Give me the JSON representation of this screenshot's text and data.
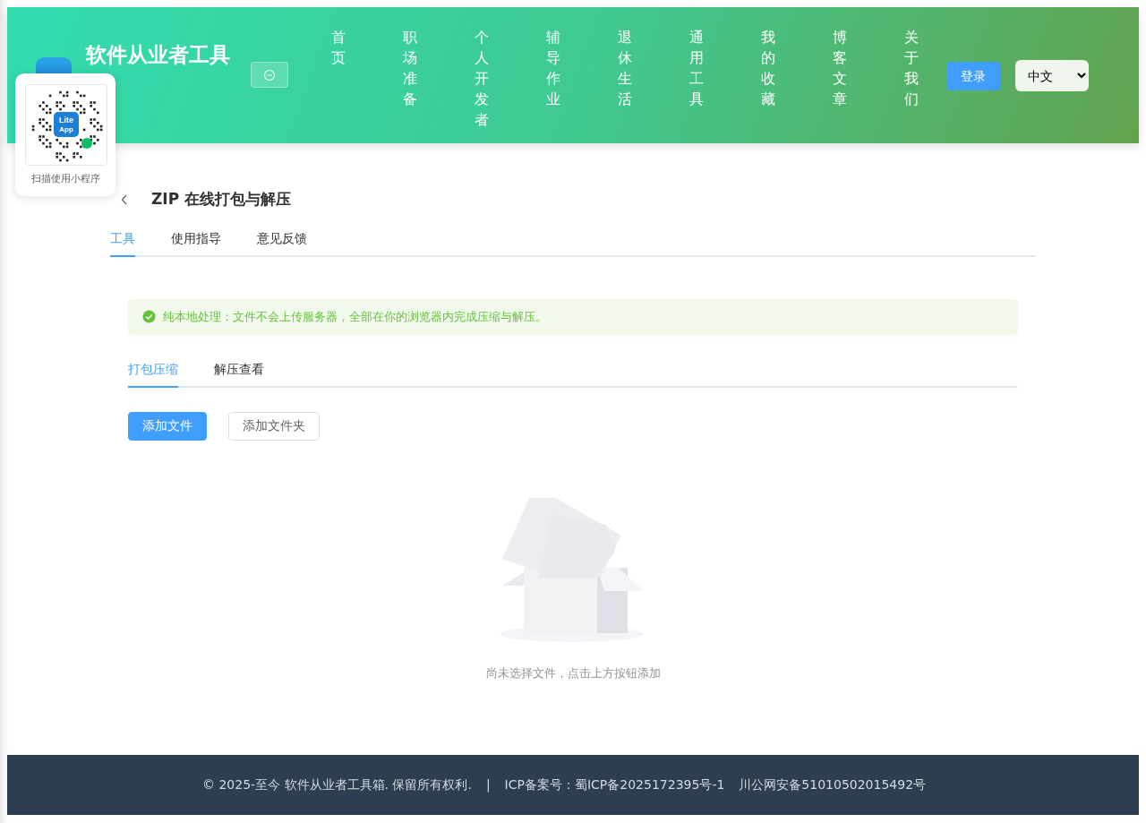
{
  "header": {
    "title": "软件从业者工具",
    "nav": [
      {
        "label": "首页"
      },
      {
        "label": "职场准备"
      },
      {
        "label": "个人开发者"
      },
      {
        "label": "辅导作业"
      },
      {
        "label": "退休生活"
      },
      {
        "label": "通用工具"
      },
      {
        "label": "我的收藏"
      },
      {
        "label": "博客文章"
      },
      {
        "label": "关于我们"
      }
    ],
    "login_button": "登录",
    "language": "中文"
  },
  "qr_popup": {
    "logo_text": [
      "Lite",
      "App"
    ],
    "caption": "扫描使用小程序"
  },
  "page": {
    "title": "ZIP 在线打包与解压",
    "tabs": [
      {
        "label": "工具",
        "selected": true
      },
      {
        "label": "使用指导",
        "selected": false
      },
      {
        "label": "意见反馈",
        "selected": false
      }
    ],
    "notice": "纯本地处理：文件不会上传服务器，全部在你的浏览器内完成压缩与解压。",
    "subtabs": [
      {
        "label": "打包压缩",
        "selected": true
      },
      {
        "label": "解压查看",
        "selected": false
      }
    ],
    "buttons": [
      {
        "label": "添加文件",
        "kind": "primary"
      },
      {
        "label": "添加文件夹",
        "kind": "plain"
      }
    ],
    "empty_text": "尚未选择文件，点击上方按钮添加"
  },
  "footer": {
    "copyright": "© 2025-至今 软件从业者工具箱. 保留所有权利.",
    "separator": "|",
    "icp": "ICP备案号：蜀ICP备2025172395号-1",
    "police": "川公网安备51010502015492号"
  }
}
